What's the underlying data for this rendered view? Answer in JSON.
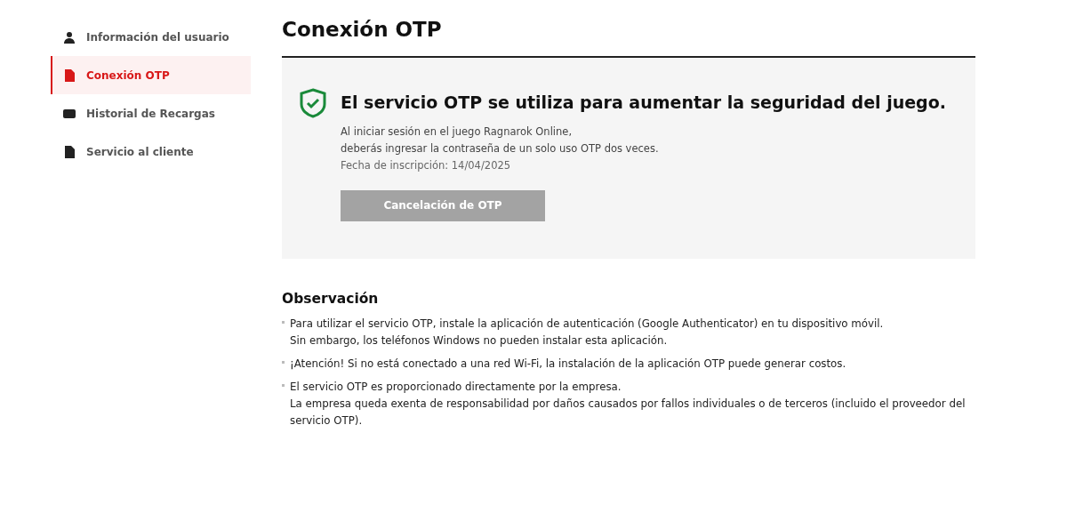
{
  "sidebar": {
    "items": [
      {
        "label": "Información del usuario",
        "kind": "user",
        "selected": false
      },
      {
        "label": "Conexión OTP",
        "kind": "document",
        "selected": true
      },
      {
        "label": "Historial de Recargas",
        "kind": "card",
        "selected": false
      },
      {
        "label": "Servicio al cliente",
        "kind": "document",
        "selected": false
      }
    ]
  },
  "page_title": "Conexión OTP",
  "panel": {
    "heading": "El servicio OTP se utiliza para aumentar la seguridad del juego.",
    "description": [
      "Al iniciar sesión en el juego Ragnarok Online,",
      "deberás ingresar la contraseña de un solo uso OTP dos veces."
    ],
    "registration_date": "Fecha de inscripción: 14/04/2025",
    "button": {
      "label": "Cancelación de OTP",
      "disabled": true
    }
  },
  "notes": {
    "heading": "Observación",
    "items": [
      {
        "lines": [
          "Para utilizar el servicio OTP, instale la aplicación de autenticación (Google Authenticator) en tu dispositivo móvil.",
          "Sin embargo, los teléfonos Windows no pueden instalar esta aplicación."
        ]
      },
      {
        "lines": [
          "¡Atención! Si no está conectado a una red Wi-Fi, la instalación de la aplicación OTP puede generar costos."
        ]
      },
      {
        "lines": [
          "El servicio OTP es proporcionado directamente por la empresa.",
          "La empresa queda exenta de responsabilidad por daños causados por fallos individuales o de terceros (incluido el proveedor del servicio OTP)."
        ]
      }
    ]
  }
}
